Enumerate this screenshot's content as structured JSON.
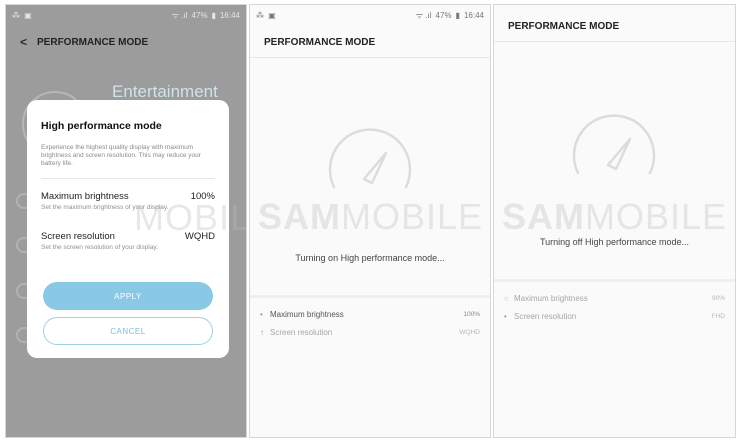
{
  "screen1": {
    "status": {
      "left": "⁂ ▣",
      "signal": "ᯤ .ıl",
      "battery": "47%",
      "time": "16:44"
    },
    "title": "PERFORMANCE MODE",
    "background_heading": "Entertainment",
    "dialog": {
      "title": "High performance mode",
      "description": "Experience the highest quality display with maximum brightness and screen resolution. This may reduce your battery life.",
      "options": [
        {
          "label": "Maximum brightness",
          "value": "100%",
          "sub": "Set the maximum brightness of your display."
        },
        {
          "label": "Screen resolution",
          "value": "WQHD",
          "sub": "Set the screen resolution of your display."
        }
      ],
      "apply_label": "APPLY",
      "cancel_label": "CANCEL"
    }
  },
  "screen2": {
    "status": {
      "left": "⁂ ▣",
      "signal": "ᯤ .ıl",
      "battery": "47%",
      "time": "16:44"
    },
    "title": "PERFORMANCE MODE",
    "message": "Turning on High performance mode...",
    "items": [
      {
        "mark": "•",
        "label": "Maximum brightness",
        "value": "100%"
      },
      {
        "mark": "↑",
        "label": "Screen resolution",
        "value": "WQHD"
      }
    ]
  },
  "screen3": {
    "title": "PERFORMANCE MODE",
    "message": "Turning off High performance mode...",
    "items": [
      {
        "mark": "○",
        "label": "Maximum brightness",
        "value": "90%"
      },
      {
        "mark": "•",
        "label": "Screen resolution",
        "value": "FHD"
      }
    ]
  },
  "watermark": {
    "bold": "SAM",
    "thin": "MOBILE"
  },
  "colors": {
    "accent": "#89c9e6",
    "overlay": "#9c9c9c",
    "gauge": "#dcdcdc"
  }
}
